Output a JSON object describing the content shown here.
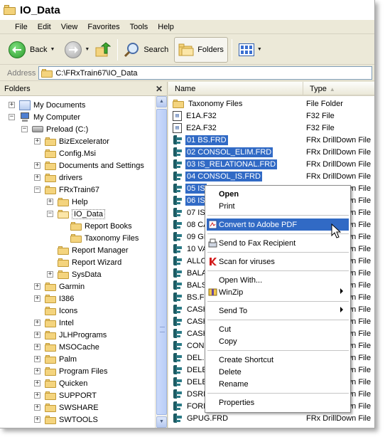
{
  "window": {
    "title": "IO_Data"
  },
  "menu": [
    "File",
    "Edit",
    "View",
    "Favorites",
    "Tools",
    "Help"
  ],
  "toolbar": {
    "back_label": "Back",
    "search_label": "Search",
    "folders_label": "Folders"
  },
  "address": {
    "label": "Address",
    "value": "C:\\FRxTrain67\\IO_Data"
  },
  "folders_pane": {
    "title": "Folders",
    "close_glyph": "✕",
    "items": [
      {
        "label": "My Documents",
        "toggle": "+"
      },
      {
        "label": "My Computer",
        "toggle": "−"
      },
      {
        "label": "Preload (C:)",
        "toggle": "−"
      },
      {
        "label": "BizExcelerator",
        "toggle": "+"
      },
      {
        "label": "Config.Msi",
        "toggle": ""
      },
      {
        "label": "Documents and Settings",
        "toggle": "+"
      },
      {
        "label": "drivers",
        "toggle": "+"
      },
      {
        "label": "FRxTrain67",
        "toggle": "−"
      },
      {
        "label": "Help",
        "toggle": "+"
      },
      {
        "label": "IO_Data",
        "toggle": "−"
      },
      {
        "label": "Report Books",
        "toggle": ""
      },
      {
        "label": "Taxonomy Files",
        "toggle": ""
      },
      {
        "label": "Report Manager",
        "toggle": ""
      },
      {
        "label": "Report Wizard",
        "toggle": ""
      },
      {
        "label": "SysData",
        "toggle": "+"
      },
      {
        "label": "Garmin",
        "toggle": "+"
      },
      {
        "label": "I386",
        "toggle": "+"
      },
      {
        "label": "Icons",
        "toggle": ""
      },
      {
        "label": "Intel",
        "toggle": "+"
      },
      {
        "label": "JLHPrograms",
        "toggle": "+"
      },
      {
        "label": "MSOCache",
        "toggle": "+"
      },
      {
        "label": "Palm",
        "toggle": "+"
      },
      {
        "label": "Program Files",
        "toggle": "+"
      },
      {
        "label": "Quicken",
        "toggle": "+"
      },
      {
        "label": "SUPPORT",
        "toggle": "+"
      },
      {
        "label": "SWSHARE",
        "toggle": "+"
      },
      {
        "label": "SWTOOLS",
        "toggle": "+"
      }
    ]
  },
  "files_pane": {
    "columns": {
      "name": "Name",
      "type": "Type"
    },
    "rows": [
      {
        "name": "Taxonomy Files",
        "type": "File Folder",
        "icon": "folder-icon",
        "selected": false
      },
      {
        "name": "E1A.F32",
        "type": "F32 File",
        "icon": "f32-file-icon",
        "selected": false
      },
      {
        "name": "E2A.F32",
        "type": "F32 File",
        "icon": "f32-file-icon",
        "selected": false
      },
      {
        "name": "01 BS.FRD",
        "type": "FRx DrillDown File",
        "icon": "frd-file-icon",
        "selected": true
      },
      {
        "name": "02 CONSOL_ELIM.FRD",
        "type": "FRx DrillDown File",
        "icon": "frd-file-icon",
        "selected": true
      },
      {
        "name": "03 IS_RELATIONAL.FRD",
        "type": "FRx DrillDown File",
        "icon": "frd-file-icon",
        "selected": true
      },
      {
        "name": "04 CONSOL_IS.FRD",
        "type": "FRx DrillDown File",
        "icon": "frd-file-icon",
        "selected": true
      },
      {
        "name": "05 IS",
        "type": "FRx DrillDown File",
        "icon": "frd-file-icon",
        "selected": true
      },
      {
        "name": "06 IS",
        "type": "FRx DrillDown File",
        "icon": "frd-file-icon",
        "selected": true
      },
      {
        "name": "07 IS",
        "type": "FRx DrillDown File",
        "icon": "frd-file-icon",
        "selected": false
      },
      {
        "name": "08 CA",
        "type": "FRx DrillDown File",
        "icon": "frd-file-icon",
        "selected": false
      },
      {
        "name": "09 GR",
        "type": "FRx DrillDown File",
        "icon": "frd-file-icon",
        "selected": false
      },
      {
        "name": "10 VA",
        "type": "FRx DrillDown File",
        "icon": "frd-file-icon",
        "selected": false
      },
      {
        "name": "ALLOC",
        "type": "FRx DrillDown File",
        "icon": "frd-file-icon",
        "selected": false
      },
      {
        "name": "BALAN",
        "type": "FRx DrillDown File",
        "icon": "frd-file-icon",
        "selected": false
      },
      {
        "name": "BALSH",
        "type": "FRx DrillDown File",
        "icon": "frd-file-icon",
        "selected": false
      },
      {
        "name": "BS.FR",
        "type": "FRx DrillDown File",
        "icon": "frd-file-icon",
        "selected": false
      },
      {
        "name": "CASH",
        "type": "FRx DrillDown File",
        "icon": "frd-file-icon",
        "selected": false
      },
      {
        "name": "CASH",
        "type": "FRx DrillDown File",
        "icon": "frd-file-icon",
        "selected": false
      },
      {
        "name": "CASH",
        "type": "FRx DrillDown File",
        "icon": "frd-file-icon",
        "selected": false
      },
      {
        "name": "CONS",
        "type": "FRx DrillDown File",
        "icon": "frd-file-icon",
        "selected": false
      },
      {
        "name": "DEL.F",
        "type": "FRx DrillDown File",
        "icon": "frd-file-icon",
        "selected": false
      },
      {
        "name": "DELET",
        "type": "FRx DrillDown File",
        "icon": "frd-file-icon",
        "selected": false
      },
      {
        "name": "DELET",
        "type": "FRx DrillDown File",
        "icon": "frd-file-icon",
        "selected": false
      },
      {
        "name": "DSRPA",
        "type": "FRx DrillDown File",
        "icon": "frd-file-icon",
        "selected": false
      },
      {
        "name": "FORM",
        "type": "FRx DrillDown File",
        "icon": "frd-file-icon",
        "selected": false
      },
      {
        "name": "GPUG.FRD",
        "type": "FRx DrillDown File",
        "icon": "frd-file-icon",
        "selected": false
      }
    ]
  },
  "context_menu": {
    "items": [
      {
        "label": "Open",
        "kind": "item",
        "bold": true
      },
      {
        "label": "Print",
        "kind": "item"
      },
      {
        "kind": "sep"
      },
      {
        "label": "Convert to Adobe PDF",
        "kind": "item",
        "highlight": true,
        "icon": "pdf-icon"
      },
      {
        "kind": "sep"
      },
      {
        "label": "Send to Fax Recipient",
        "kind": "item",
        "icon": "fax-icon"
      },
      {
        "kind": "sep"
      },
      {
        "label": "Scan for viruses",
        "kind": "item",
        "icon": "antivirus-icon"
      },
      {
        "kind": "sep"
      },
      {
        "label": "Open With...",
        "kind": "item"
      },
      {
        "label": "WinZip",
        "kind": "item",
        "submenu": true,
        "icon": "winzip-icon"
      },
      {
        "kind": "sep"
      },
      {
        "label": "Send To",
        "kind": "item",
        "submenu": true
      },
      {
        "kind": "sep"
      },
      {
        "label": "Cut",
        "kind": "item"
      },
      {
        "label": "Copy",
        "kind": "item"
      },
      {
        "kind": "sep"
      },
      {
        "label": "Create Shortcut",
        "kind": "item"
      },
      {
        "label": "Delete",
        "kind": "item"
      },
      {
        "label": "Rename",
        "kind": "item"
      },
      {
        "kind": "sep"
      },
      {
        "label": "Properties",
        "kind": "item"
      }
    ]
  },
  "colors": {
    "selection": "#316ac5",
    "chrome": "#ece9d8",
    "folder": "#f4d47e"
  }
}
